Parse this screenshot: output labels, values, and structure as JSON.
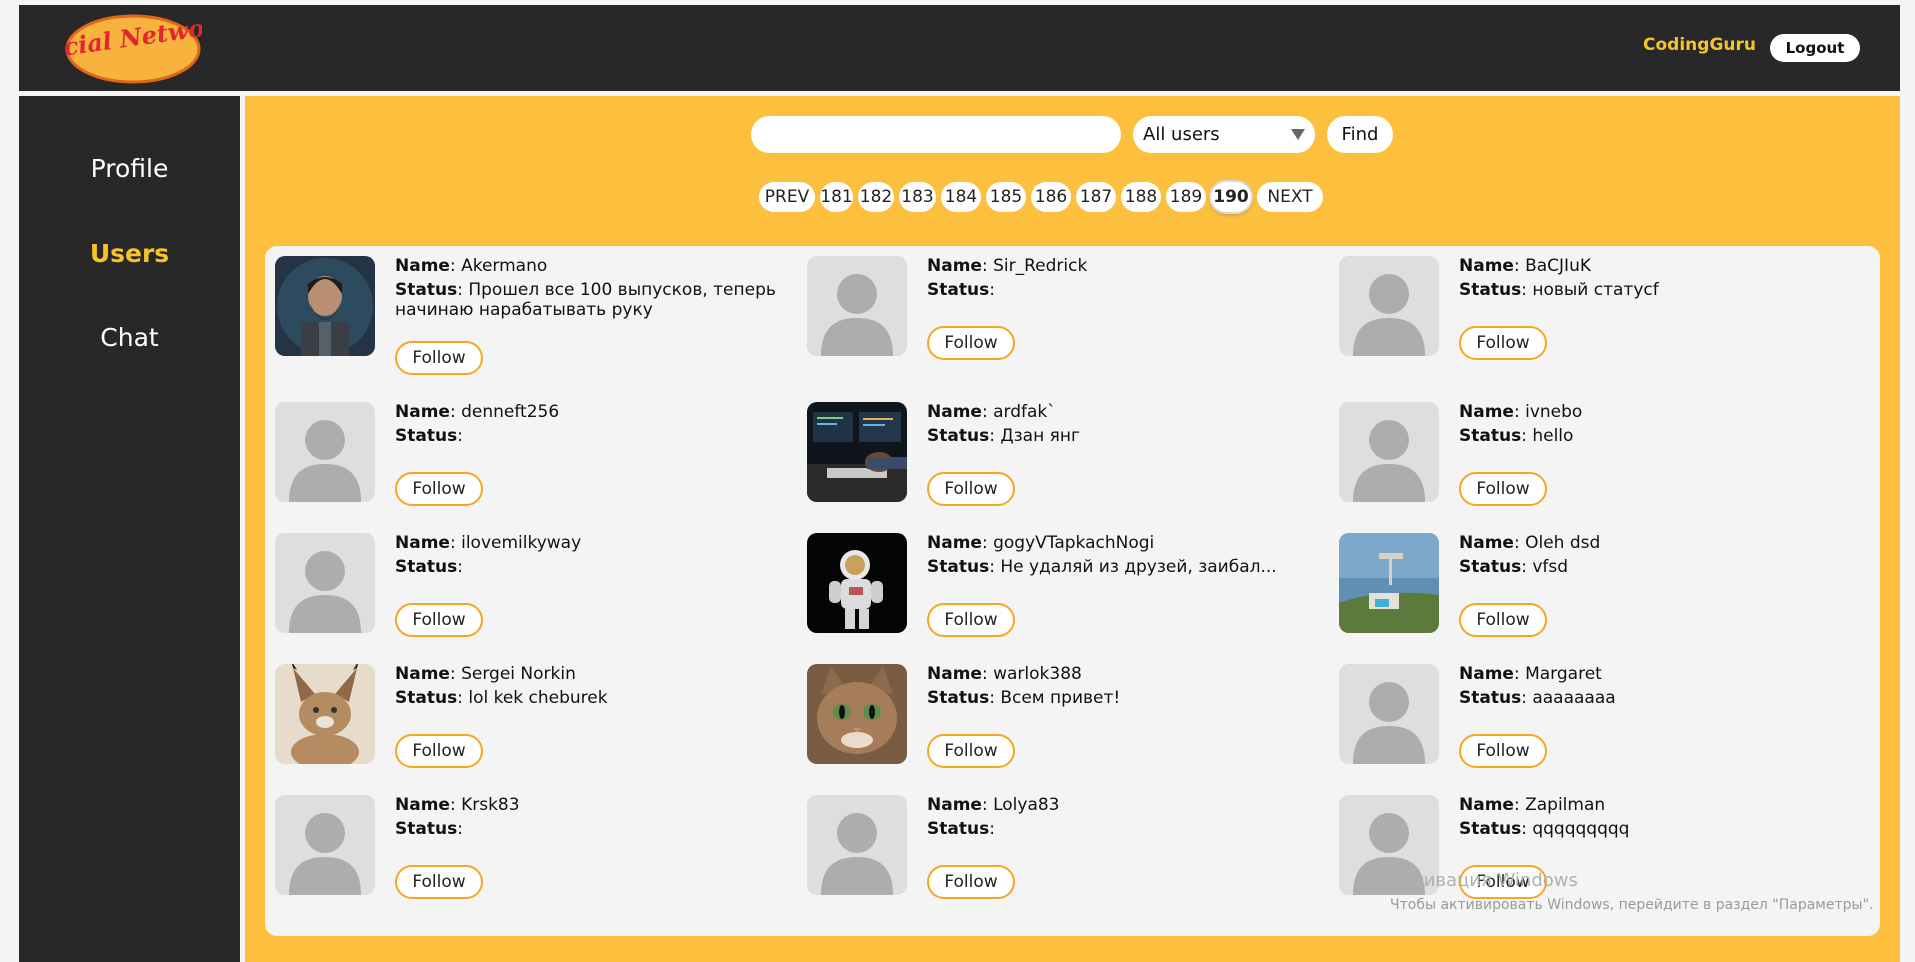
{
  "header": {
    "logo_text": "Social Network",
    "user_name": "CodingGuru",
    "logout_label": "Logout"
  },
  "sidebar": {
    "items": [
      {
        "label": "Profile",
        "active": false
      },
      {
        "label": "Users",
        "active": true
      },
      {
        "label": "Chat",
        "active": false
      }
    ]
  },
  "search": {
    "value": "",
    "filter_selected": "All users",
    "find_label": "Find"
  },
  "pagination": {
    "prev_label": "PREV",
    "next_label": "NEXT",
    "pages": [
      "181",
      "182",
      "183",
      "184",
      "185",
      "186",
      "187",
      "188",
      "189",
      "190"
    ],
    "current": "190"
  },
  "labels": {
    "name": "Name",
    "status": "Status",
    "follow": "Follow"
  },
  "users": [
    {
      "name": "Akermano",
      "status": "Прошел все 100 выпусков, теперь начинаю нарабатывать руку",
      "avatar": "bearded-man-art"
    },
    {
      "name": "Sir_Redrick",
      "status": "",
      "avatar": "default"
    },
    {
      "name": "BaCJIuK",
      "status": "новый статусf",
      "avatar": "default"
    },
    {
      "name": "denneft256",
      "status": "",
      "avatar": "default"
    },
    {
      "name": "ardfak`",
      "status": "Дзан янг",
      "avatar": "coder-screens"
    },
    {
      "name": "ivnebo",
      "status": "hello",
      "avatar": "default"
    },
    {
      "name": "ilovemilkyway",
      "status": "",
      "avatar": "default"
    },
    {
      "name": "gogyVTapkachNogi",
      "status": "Не удаляй из друзей, заибал...",
      "avatar": "astronaut"
    },
    {
      "name": "Oleh dsd",
      "status": "vfsd",
      "avatar": "coast-aerial"
    },
    {
      "name": "Sergei Norkin",
      "status": "lol kek cheburek",
      "avatar": "caracal"
    },
    {
      "name": "warlok388",
      "status": "Всем привет!",
      "avatar": "cat"
    },
    {
      "name": "Margaret",
      "status": "aaaaaaaa",
      "avatar": "default"
    },
    {
      "name": "Krsk83",
      "status": "",
      "avatar": "default"
    },
    {
      "name": "Lolya83",
      "status": "",
      "avatar": "default"
    },
    {
      "name": "Zapilman",
      "status": "qqqqqqqqq",
      "avatar": "default"
    }
  ],
  "watermark": {
    "title": "Активация Windows",
    "subtitle": "Чтобы активировать Windows, перейдите в раздел \"Параметры\"."
  },
  "colors": {
    "accent": "#fcbf3e",
    "dark": "#282828",
    "highlight": "#f7c32c",
    "follow_border": "#f7a620"
  }
}
